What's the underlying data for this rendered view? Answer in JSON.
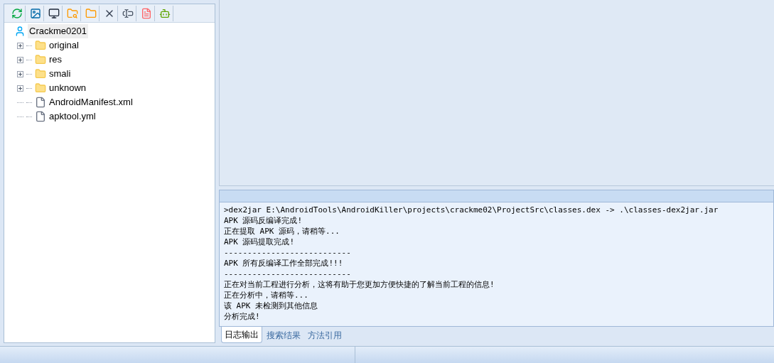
{
  "tree": {
    "root": {
      "label": "Crackme0201",
      "selected": true
    },
    "children": [
      {
        "kind": "folder",
        "label": "original",
        "expanded": false
      },
      {
        "kind": "folder",
        "label": "res",
        "expanded": false
      },
      {
        "kind": "folder",
        "label": "smali",
        "expanded": false
      },
      {
        "kind": "folder",
        "label": "unknown",
        "expanded": false
      },
      {
        "kind": "file",
        "label": "AndroidManifest.xml"
      },
      {
        "kind": "file",
        "label": "apktool.yml"
      }
    ]
  },
  "log": {
    "lines": [
      ">dex2jar E:\\AndroidTools\\AndroidKiller\\projects\\crackme02\\ProjectSrc\\classes.dex -> .\\classes-dex2jar.jar",
      "APK 源码反编译完成!",
      "正在提取 APK 源码，请稍等...",
      "APK 源码提取完成!",
      "---------------------------",
      "APK 所有反编译工作全部完成!!!",
      "---------------------------",
      "正在对当前工程进行分析，这将有助于您更加方便快捷的了解当前工程的信息!",
      "正在分析中，请稍等...",
      "该 APK 未检测到其他信息",
      "分析完成!"
    ]
  },
  "log_tabs": [
    {
      "label": "日志输出",
      "selected": true
    },
    {
      "label": "搜索结果",
      "selected": false
    },
    {
      "label": "方法引用",
      "selected": false
    }
  ]
}
